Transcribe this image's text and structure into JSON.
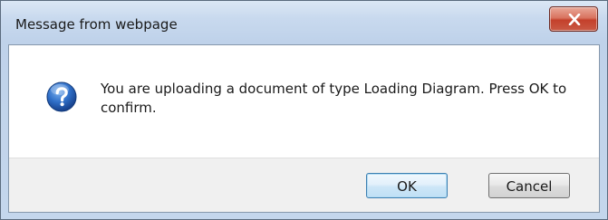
{
  "window": {
    "title": "Message from webpage"
  },
  "icons": {
    "close": "close-icon",
    "question": "question-icon"
  },
  "dialog": {
    "message": "You are uploading a document of type Loading Diagram. Press OK to confirm."
  },
  "buttons": {
    "ok_label": "OK",
    "cancel_label": "Cancel"
  },
  "colors": {
    "close_button": "#c4402b",
    "question_icon": "#1f5fb8",
    "title_bar": "#c8d9ee"
  }
}
